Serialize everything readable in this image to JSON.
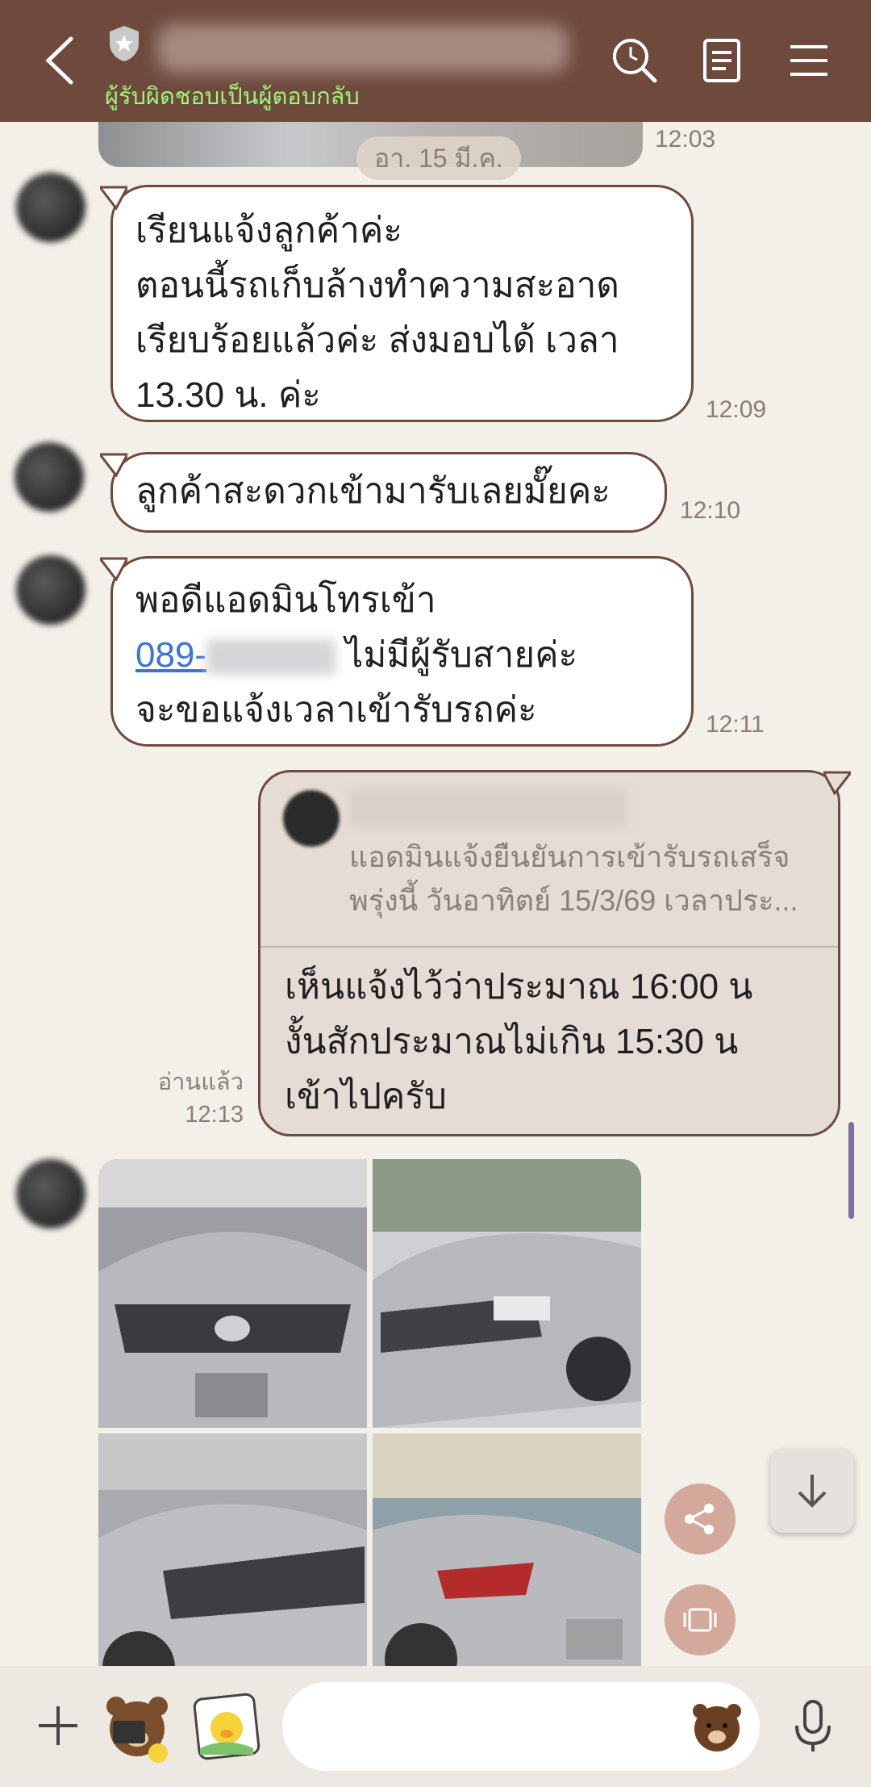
{
  "header": {
    "subtitle": "ผู้รับผิดชอบเป็นผู้ตอบกลับ"
  },
  "chat": {
    "date_label": "อา. 15 มี.ค.",
    "first_time": "12:03",
    "messages": [
      {
        "lines": [
          "เรียนแจ้งลูกค้าค่ะ",
          "ตอนนี้รถเก็บล้างทำความสะอาด",
          "เรียบร้อยแล้วค่ะ  ส่งมอบได้ เวลา",
          "13.30 น. ค่ะ"
        ],
        "time": "12:09"
      },
      {
        "lines": [
          "ลูกค้าสะดวกเข้ามารับเลยมั๊ยคะ"
        ],
        "time": "12:10"
      },
      {
        "line1": "พอดีแอดมินโทรเข้า",
        "link": "089-",
        "line2_rest": " ไม่มีผู้รับสายค่ะ",
        "line3": "จะขอแจ้งเวลาเข้ารับรถค่ะ",
        "time": "12:11"
      }
    ],
    "my_message": {
      "quote_line1": "แอดมินแจ้งยืนยันการเข้ารับรถเสร็จ",
      "quote_line2": "พรุ่งนี้ วันอาทิตย์ 15/3/69 เวลาประ...",
      "lines": [
        "เห็นแจ้งไว้ว่าประมาณ 16:00 น",
        "งั้นสักประมาณไม่เกิน 15:30 น",
        "เข้าไปครับ"
      ],
      "read_label": "อ่านแล้ว",
      "time": "12:13"
    }
  },
  "composer": {
    "placeholder": ""
  }
}
